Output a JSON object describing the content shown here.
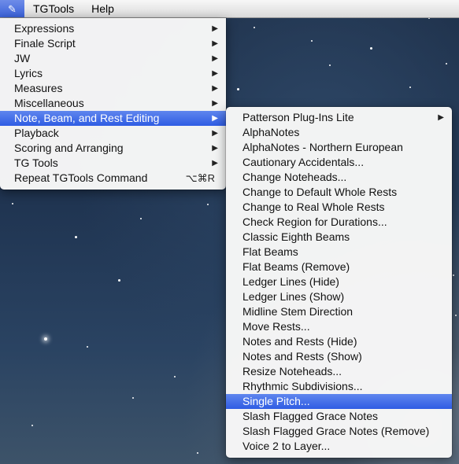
{
  "menubar": {
    "app_icon": "tgtools-app-icon",
    "items": [
      "TGTools",
      "Help"
    ]
  },
  "tgtools_menu": {
    "items": [
      {
        "label": "Expressions",
        "submenu": true
      },
      {
        "label": "Finale Script",
        "submenu": true
      },
      {
        "label": "JW",
        "submenu": true
      },
      {
        "label": "Lyrics",
        "submenu": true
      },
      {
        "label": "Measures",
        "submenu": true
      },
      {
        "label": "Miscellaneous",
        "submenu": true
      },
      {
        "label": "Note, Beam, and Rest Editing",
        "submenu": true,
        "selected": true
      },
      {
        "label": "Playback",
        "submenu": true
      },
      {
        "label": "Scoring and Arranging",
        "submenu": true
      },
      {
        "label": "TG Tools",
        "submenu": true
      },
      {
        "label": "Repeat TGTools Command",
        "shortcut": "⌥⌘R"
      }
    ],
    "arrow_glyph": "▶"
  },
  "submenu": {
    "items": [
      {
        "label": "Patterson Plug-Ins Lite",
        "submenu": true
      },
      {
        "label": "AlphaNotes"
      },
      {
        "label": "AlphaNotes - Northern European"
      },
      {
        "label": "Cautionary Accidentals..."
      },
      {
        "label": "Change Noteheads..."
      },
      {
        "label": "Change to Default Whole Rests"
      },
      {
        "label": "Change to Real Whole Rests"
      },
      {
        "label": "Check Region for Durations..."
      },
      {
        "label": "Classic Eighth Beams"
      },
      {
        "label": "Flat Beams"
      },
      {
        "label": "Flat Beams (Remove)"
      },
      {
        "label": "Ledger Lines (Hide)"
      },
      {
        "label": "Ledger Lines (Show)"
      },
      {
        "label": "Midline Stem Direction"
      },
      {
        "label": "Move Rests..."
      },
      {
        "label": "Notes and Rests (Hide)"
      },
      {
        "label": "Notes and Rests (Show)"
      },
      {
        "label": "Resize Noteheads..."
      },
      {
        "label": "Rhythmic Subdivisions..."
      },
      {
        "label": "Single Pitch...",
        "selected": true
      },
      {
        "label": "Slash Flagged Grace Notes"
      },
      {
        "label": "Slash Flagged Grace Notes (Remove)"
      },
      {
        "label": "Voice 2 to Layer..."
      }
    ]
  },
  "colors": {
    "highlight": "#3a62d9",
    "menu_background": "#f6f6f6",
    "desktop": "#1f3350"
  }
}
